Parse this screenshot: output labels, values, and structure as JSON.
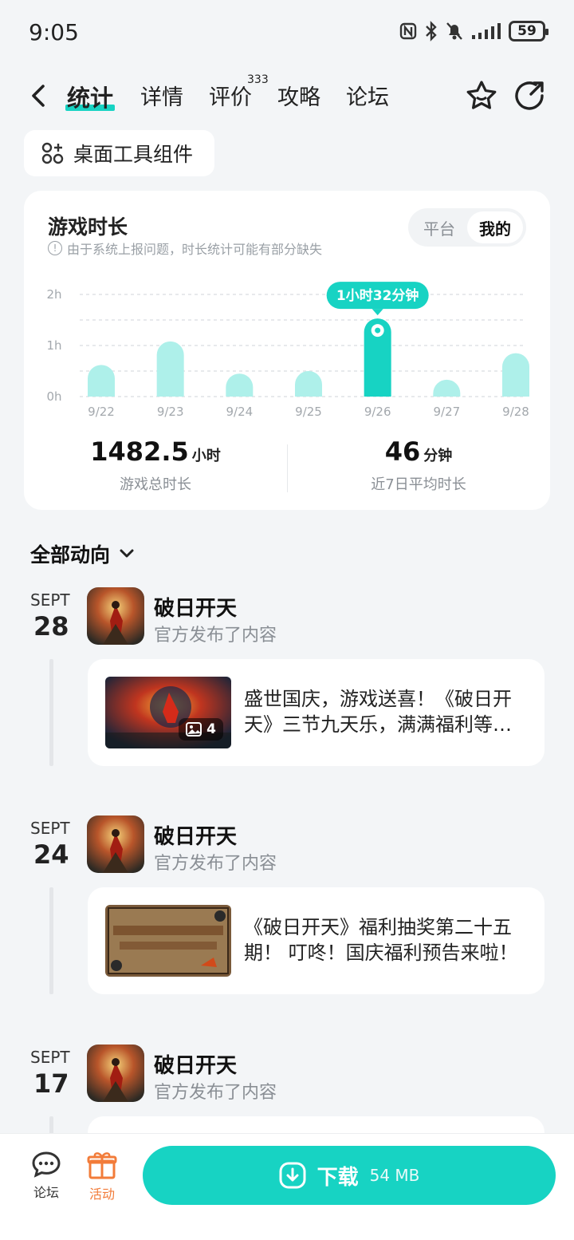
{
  "status_bar": {
    "time": "9:05",
    "battery": "59"
  },
  "nav": {
    "tabs": [
      {
        "label": "统计"
      },
      {
        "label": "详情"
      },
      {
        "label": "评价",
        "badge": "333"
      },
      {
        "label": "攻略"
      },
      {
        "label": "论坛"
      }
    ],
    "active_tab": "统计"
  },
  "widget_chip": {
    "label": "桌面工具组件"
  },
  "stats": {
    "title": "游戏时长",
    "note": "由于系统上报问题，时长统计可能有部分缺失",
    "toggle": {
      "options": [
        "平台",
        "我的"
      ],
      "selected": "我的"
    },
    "total": {
      "value": "1482.5",
      "unit": "小时",
      "label": "游戏总时长"
    },
    "average": {
      "value": "46",
      "unit": "分钟",
      "label": "近7日平均时长"
    }
  },
  "chart_data": {
    "type": "bar",
    "categories": [
      "9/22",
      "9/23",
      "9/24",
      "9/25",
      "9/26",
      "9/27",
      "9/28"
    ],
    "values": [
      0.62,
      1.08,
      0.45,
      0.5,
      1.53,
      0.33,
      0.85
    ],
    "y_unit": "hours",
    "y_ticks": [
      "0h",
      "1h",
      "2h"
    ],
    "ylim": [
      0,
      2
    ],
    "highlight_index": 4,
    "highlight_label": "1小时32分钟",
    "colors": {
      "bar": "#aef0ea",
      "highlight": "#17d3c3"
    },
    "grid": true
  },
  "feed": {
    "header": "全部动向",
    "items": [
      {
        "month": "SEPT",
        "day": "28",
        "game": "破日开天",
        "subtitle": "官方发布了内容",
        "title": "盛世国庆，游戏送喜！《破日开天》三节九天乐，满满福利等你来！",
        "image_count": "4"
      },
      {
        "month": "SEPT",
        "day": "24",
        "game": "破日开天",
        "subtitle": "官方发布了内容",
        "title": "《破日开天》福利抽奖第二十五期！ 叮咚！国庆福利预告来啦！"
      },
      {
        "month": "SEPT",
        "day": "17",
        "game": "破日开天",
        "subtitle": "官方发布了内容"
      }
    ]
  },
  "bottom_bar": {
    "forum_label": "论坛",
    "activity_label": "活动",
    "download_label": "下载",
    "download_size": "54 MB"
  },
  "colors": {
    "accent": "#17d3c3",
    "activity": "#f27c3a",
    "background": "#f3f5f7"
  }
}
